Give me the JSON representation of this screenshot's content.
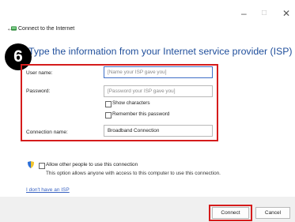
{
  "window": {
    "minimize_glyph": "–",
    "maximize_glyph": "□",
    "close_glyph": "✕",
    "back_glyph": "←",
    "title": "Connect to the Internet"
  },
  "step": {
    "number": "6"
  },
  "heading": "Type the information from your Internet service provider (ISP)",
  "form": {
    "username_label": "User name:",
    "username_placeholder": "[Name your ISP gave you]",
    "password_label": "Password:",
    "password_placeholder": "[Password your ISP gave you]",
    "show_characters": "Show characters",
    "remember_password": "Remember this password",
    "connection_name_label": "Connection name:",
    "connection_name_value": "Broadband Connection"
  },
  "sharing": {
    "allow_label": "Allow other people to use this connection",
    "allow_description": "This option allows anyone with access to this computer to use this connection."
  },
  "links": {
    "no_isp": "I don't have an ISP"
  },
  "buttons": {
    "connect": "Connect",
    "cancel": "Cancel"
  },
  "colors": {
    "accent": "#1f4e9b",
    "highlight": "#d51c1c",
    "link": "#3a63c2"
  },
  "icons": [
    "back-arrow-icon",
    "network-icon",
    "shield-icon"
  ]
}
